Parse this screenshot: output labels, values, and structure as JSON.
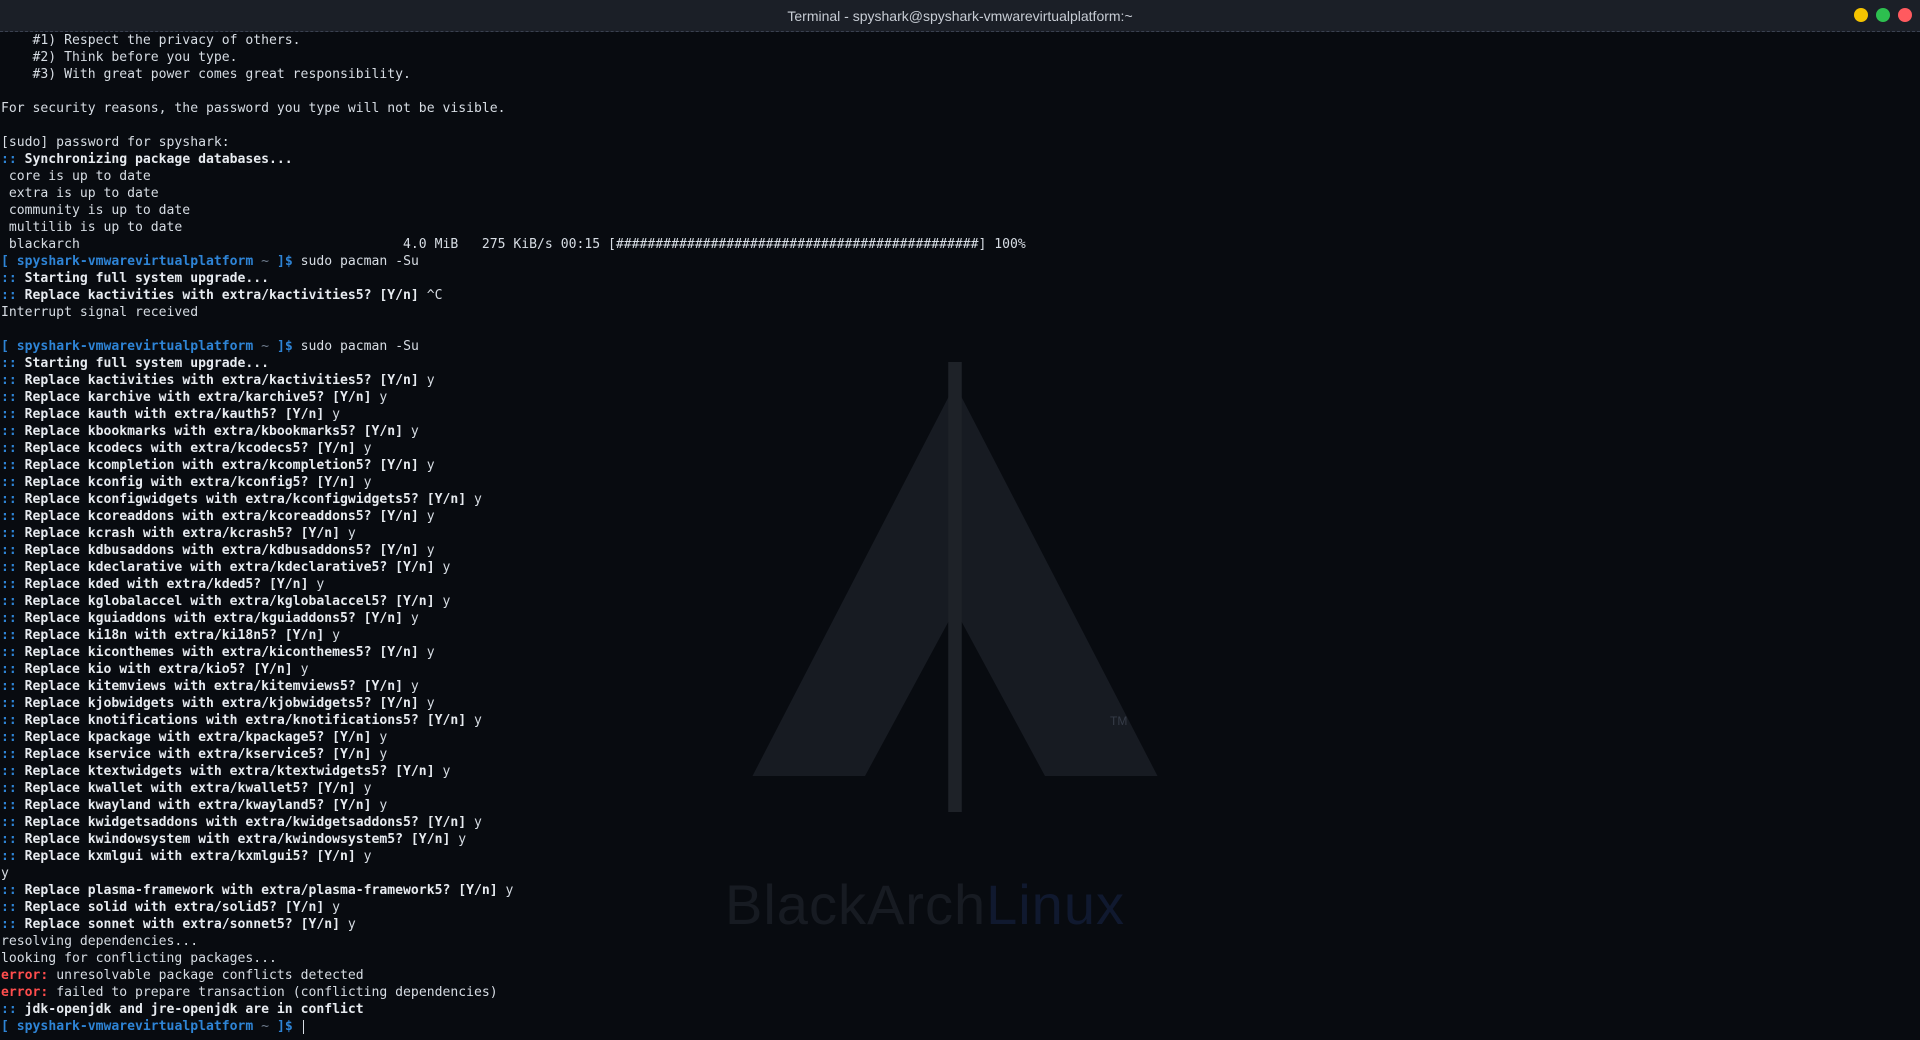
{
  "window": {
    "title": "Terminal - spyshark@spyshark-vmwarevirtualplatform:~",
    "buttons": [
      "minimize",
      "maximize",
      "close"
    ]
  },
  "theme": {
    "prompt_color": "#2e84d6",
    "error_color": "#ff4d4d",
    "text_color": "#d7dde4",
    "background": "#080b10"
  },
  "watermark": {
    "brand": "BlackArch",
    "brand_suffix": "Linux",
    "tm": "TM"
  },
  "prompt": {
    "open": "[ ",
    "host": "spyshark-vmwarevirtualplatform",
    "path": " ~ ",
    "close": "]$ "
  },
  "terminal": {
    "l1": "    #1) Respect the privacy of others.",
    "l2": "    #2) Think before you type.",
    "l3": "    #3) With great power comes great responsibility.",
    "l4": "",
    "l5": "For security reasons, the password you type will not be visible.",
    "l6": "",
    "l7": "[sudo] password for spyshark:",
    "l8a": ":: ",
    "l8b": "Synchronizing package databases...",
    "l9": " core is up to date",
    "l10": " extra is up to date",
    "l11": " community is up to date",
    "l12": " multilib is up to date",
    "l13": " blackarch                                         4.0 MiB   275 KiB/s 00:15 [##############################################] 100%",
    "l14cmd": "sudo pacman -Su",
    "l15a": ":: ",
    "l15b": "Starting full system upgrade...",
    "l16a": ":: ",
    "l16b": "Replace kactivities with extra/kactivities5? [Y/n]",
    "l16c": " ^C",
    "l17": "Interrupt signal received",
    "l18": "",
    "l19cmd": "sudo pacman -Su",
    "l20a": ":: ",
    "l20b": "Starting full system upgrade...",
    "replace": [
      {
        "q": "Replace kactivities with extra/kactivities5? [Y/n]",
        "a": " y"
      },
      {
        "q": "Replace karchive with extra/karchive5? [Y/n]",
        "a": " y"
      },
      {
        "q": "Replace kauth with extra/kauth5? [Y/n]",
        "a": " y"
      },
      {
        "q": "Replace kbookmarks with extra/kbookmarks5? [Y/n]",
        "a": " y"
      },
      {
        "q": "Replace kcodecs with extra/kcodecs5? [Y/n]",
        "a": " y"
      },
      {
        "q": "Replace kcompletion with extra/kcompletion5? [Y/n]",
        "a": " y"
      },
      {
        "q": "Replace kconfig with extra/kconfig5? [Y/n]",
        "a": " y"
      },
      {
        "q": "Replace kconfigwidgets with extra/kconfigwidgets5? [Y/n]",
        "a": " y"
      },
      {
        "q": "Replace kcoreaddons with extra/kcoreaddons5? [Y/n]",
        "a": " y"
      },
      {
        "q": "Replace kcrash with extra/kcrash5? [Y/n]",
        "a": " y"
      },
      {
        "q": "Replace kdbusaddons with extra/kdbusaddons5? [Y/n]",
        "a": " y"
      },
      {
        "q": "Replace kdeclarative with extra/kdeclarative5? [Y/n]",
        "a": " y"
      },
      {
        "q": "Replace kded with extra/kded5? [Y/n]",
        "a": " y"
      },
      {
        "q": "Replace kglobalaccel with extra/kglobalaccel5? [Y/n]",
        "a": " y"
      },
      {
        "q": "Replace kguiaddons with extra/kguiaddons5? [Y/n]",
        "a": " y"
      },
      {
        "q": "Replace ki18n with extra/ki18n5? [Y/n]",
        "a": " y"
      },
      {
        "q": "Replace kiconthemes with extra/kiconthemes5? [Y/n]",
        "a": " y"
      },
      {
        "q": "Replace kio with extra/kio5? [Y/n]",
        "a": " y"
      },
      {
        "q": "Replace kitemviews with extra/kitemviews5? [Y/n]",
        "a": " y"
      },
      {
        "q": "Replace kjobwidgets with extra/kjobwidgets5? [Y/n]",
        "a": " y"
      },
      {
        "q": "Replace knotifications with extra/knotifications5? [Y/n]",
        "a": " y"
      },
      {
        "q": "Replace kpackage with extra/kpackage5? [Y/n]",
        "a": " y"
      },
      {
        "q": "Replace kservice with extra/kservice5? [Y/n]",
        "a": " y"
      },
      {
        "q": "Replace ktextwidgets with extra/ktextwidgets5? [Y/n]",
        "a": " y"
      },
      {
        "q": "Replace kwallet with extra/kwallet5? [Y/n]",
        "a": " y"
      },
      {
        "q": "Replace kwayland with extra/kwayland5? [Y/n]",
        "a": " y"
      },
      {
        "q": "Replace kwidgetsaddons with extra/kwidgetsaddons5? [Y/n]",
        "a": " y"
      },
      {
        "q": "Replace kwindowsystem with extra/kwindowsystem5? [Y/n]",
        "a": " y"
      },
      {
        "q": "Replace kxmlgui with extra/kxmlgui5? [Y/n]",
        "a": " y"
      }
    ],
    "l50": "y",
    "replace2": [
      {
        "q": "Replace plasma-framework with extra/plasma-framework5? [Y/n]",
        "a": " y"
      },
      {
        "q": "Replace solid with extra/solid5? [Y/n]",
        "a": " y"
      },
      {
        "q": "Replace sonnet with extra/sonnet5? [Y/n]",
        "a": " y"
      }
    ],
    "l54": "resolving dependencies...",
    "l55": "looking for conflicting packages...",
    "l56a": "error:",
    "l56b": " unresolvable package conflicts detected",
    "l57a": "error:",
    "l57b": " failed to prepare transaction (conflicting dependencies)",
    "l58a": ":: ",
    "l58b": "jdk-openjdk and jre-openjdk are in conflict"
  }
}
